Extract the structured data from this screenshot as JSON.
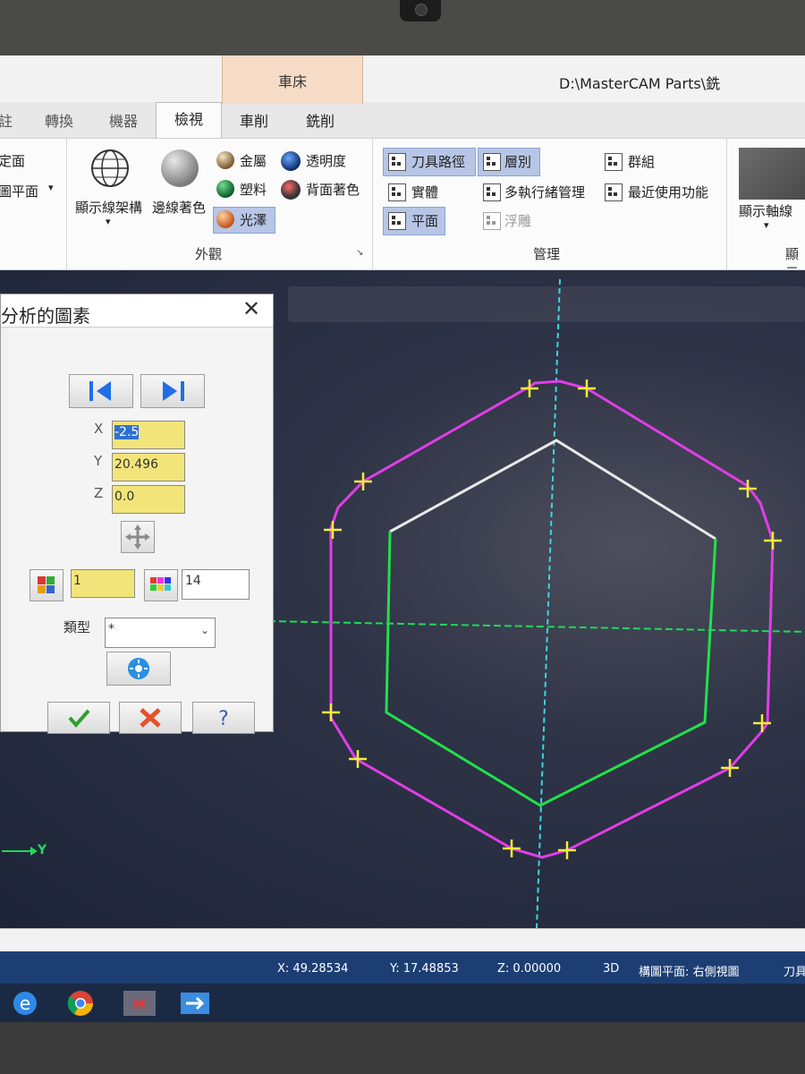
{
  "ribbon": {
    "context_group": "車床",
    "title": "D:\\MasterCAM Parts\\銑",
    "tabs": [
      "註",
      "轉換",
      "機器",
      "檢視",
      "車削",
      "銑削"
    ],
    "active_tab": "檢視",
    "left_partial": [
      "定面",
      "圖平面"
    ],
    "appearance": {
      "wireframe_label": "顯示線架構",
      "shaded_label": "邊線著色",
      "metal": "金屬",
      "plastic": "塑料",
      "gloss": "光澤",
      "transparency": "透明度",
      "backface": "背面著色",
      "group_label": "外觀"
    },
    "manage": {
      "toolpaths": "刀具路徑",
      "levels": "層別",
      "groups": "群組",
      "solids": "實體",
      "multithread": "多執行緒管理",
      "recent": "最近使用功能",
      "planes": "平面",
      "relief": "浮雕",
      "group_label": "管理"
    },
    "display": {
      "axis_label": "顯示軸線",
      "group_label": "顯示"
    }
  },
  "dialog": {
    "title": "分析的圖素",
    "x_label": "X",
    "x_value": "-2.5",
    "y_label": "Y",
    "y_value": "20.496",
    "z_label": "Z",
    "z_value": "0.0",
    "level_value": "1",
    "color_value": "14",
    "type_label": "類型",
    "type_value": "*"
  },
  "viewport": {
    "axis_label": "Y"
  },
  "status": {
    "x": "X: 49.28534",
    "y": "Y: 17.48853",
    "z": "Z: 0.00000",
    "mode": "3D",
    "plane": "構圖平面: 右側視圖",
    "tool": "刀具"
  },
  "colors": {
    "profile": "#e23de8",
    "hex_green": "#22e04a",
    "hex_white": "#e8e8e8",
    "axis_green": "#21d85c",
    "axis_cyan": "#3ad8e0",
    "marker": "#f2ee3a"
  }
}
